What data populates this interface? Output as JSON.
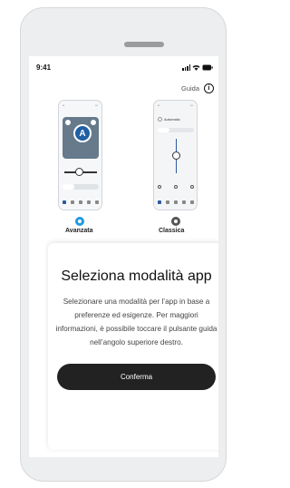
{
  "status_bar": {
    "time": "9:41"
  },
  "header": {
    "help_label": "Guida",
    "help_icon": "info-icon"
  },
  "modes": [
    {
      "id": "advanced",
      "label": "Avanzata",
      "selected": true,
      "radio_color": "#1e9ae0"
    },
    {
      "id": "classic",
      "label": "Classica",
      "selected": false,
      "radio_color": "#555555"
    }
  ],
  "classic_preview": {
    "program_label": "Automatic"
  },
  "dialog": {
    "title": "Seleziona modalità app",
    "body": "Selezionare una modalità per l’app in base a preferenze ed esigenze. Per maggiori informazioni, è possibile toccare il pulsante guida nell’angolo superiore destro.",
    "confirm_label": "Conferma"
  },
  "colors": {
    "accent": "#1e9ae0",
    "button": "#222222",
    "device": "#eceeef"
  }
}
